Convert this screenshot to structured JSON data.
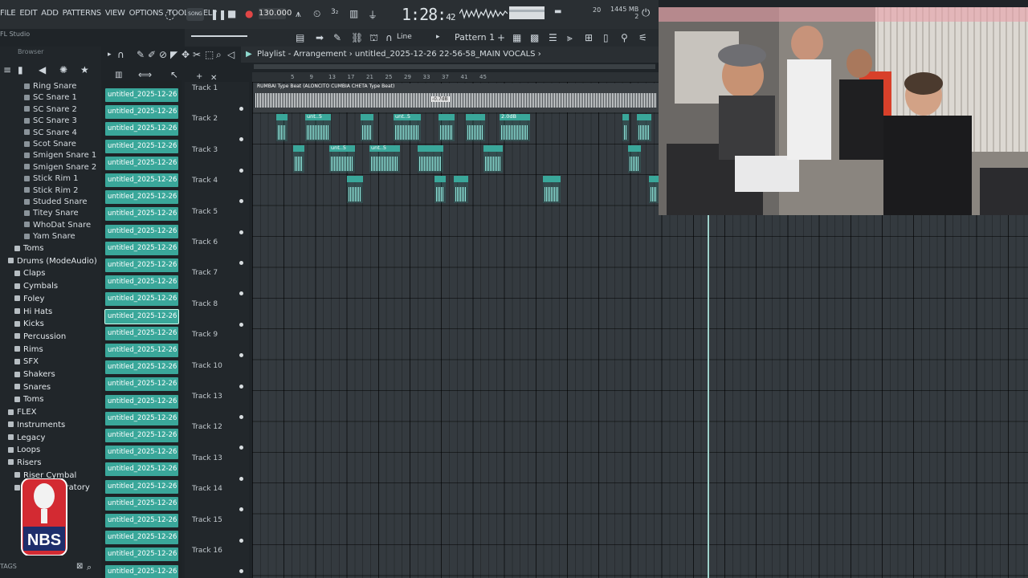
{
  "app": {
    "name": "FL Studio"
  },
  "menu": [
    "FILE",
    "EDIT",
    "ADD",
    "PATTERNS",
    "VIEW",
    "OPTIONS",
    "TOOLS",
    "HELP"
  ],
  "transport": {
    "tempo": "130.000",
    "time_main": "1:28",
    "time_sub": "42",
    "mode": "SONG"
  },
  "memory": {
    "ram": "1445 MB",
    "voices": "2",
    "cpu_num": "20"
  },
  "toolbar": {
    "pattern": "Pattern 1",
    "snap": "Line"
  },
  "playlist": {
    "title": "Playlist - Arrangement",
    "path": "untitled_2025-12-26 22-56-58_MAIN VOCALS",
    "master_label": "RUMBAI Type Beat (ALONCITO CUMBIA CHETA Type Beat)",
    "ruler": [
      "5",
      "9",
      "13",
      "17",
      "21",
      "25",
      "29",
      "33",
      "37",
      "41",
      "45"
    ],
    "tracks": [
      "Track 1",
      "Track 2",
      "Track 3",
      "Track 4",
      "Track 5",
      "Track 6",
      "Track 7",
      "Track 8",
      "Track 9",
      "Track 10",
      "Track 13",
      "Track 12",
      "Track 13",
      "Track 14",
      "Track 15",
      "Track 16"
    ],
    "clip_labels": {
      "c2a": "unt..5",
      "c2b": "unt..5",
      "c2c": "unt..5",
      "c2d": "2.0dB",
      "c3a": "unt..5",
      "c3b": "unt..5",
      "gain": "-0.7dB"
    }
  },
  "browser": {
    "header": "Browser",
    "hint": "FL Studio",
    "tags_label": "TAGS",
    "items": [
      {
        "label": "Ring Snare",
        "type": "file"
      },
      {
        "label": "SC Snare 1",
        "type": "file"
      },
      {
        "label": "SC Snare 2",
        "type": "file"
      },
      {
        "label": "SC Snare 3",
        "type": "file"
      },
      {
        "label": "SC Snare 4",
        "type": "file"
      },
      {
        "label": "Scot Snare",
        "type": "file"
      },
      {
        "label": "Smigen Snare 1",
        "type": "file"
      },
      {
        "label": "Smigen Snare 2",
        "type": "file"
      },
      {
        "label": "Stick Rim 1",
        "type": "file"
      },
      {
        "label": "Stick Rim 2",
        "type": "file"
      },
      {
        "label": "Studed Snare",
        "type": "file"
      },
      {
        "label": "Titey Snare",
        "type": "file"
      },
      {
        "label": "WhoDat Snare",
        "type": "file"
      },
      {
        "label": "Yam Snare",
        "type": "file"
      },
      {
        "label": "Toms",
        "type": "folder"
      },
      {
        "label": "Drums (ModeAudio)",
        "type": "folder"
      },
      {
        "label": "Claps",
        "type": "folder"
      },
      {
        "label": "Cymbals",
        "type": "folder"
      },
      {
        "label": "Foley",
        "type": "folder"
      },
      {
        "label": "Hi Hats",
        "type": "folder"
      },
      {
        "label": "Kicks",
        "type": "folder"
      },
      {
        "label": "Percussion",
        "type": "folder"
      },
      {
        "label": "Rims",
        "type": "folder"
      },
      {
        "label": "SFX",
        "type": "folder"
      },
      {
        "label": "Shakers",
        "type": "folder"
      },
      {
        "label": "Snares",
        "type": "folder"
      },
      {
        "label": "Toms",
        "type": "folder"
      },
      {
        "label": "FLEX",
        "type": "folder"
      },
      {
        "label": "Instruments",
        "type": "folder"
      },
      {
        "label": "Legacy",
        "type": "folder"
      },
      {
        "label": "Loops",
        "type": "folder"
      },
      {
        "label": "Risers",
        "type": "folder"
      },
      {
        "label": "Riser Cymbal",
        "type": "folder"
      },
      {
        "label": "Riser Laboratory",
        "type": "folder"
      }
    ]
  },
  "clips": {
    "label": "untitled_2025-12-26 21-",
    "count": 29
  },
  "colors": {
    "clip": "#3aa79a",
    "wave": "#8fe7dc",
    "playhead": "#9fd3cc"
  },
  "logo": {
    "text": "NBS"
  }
}
